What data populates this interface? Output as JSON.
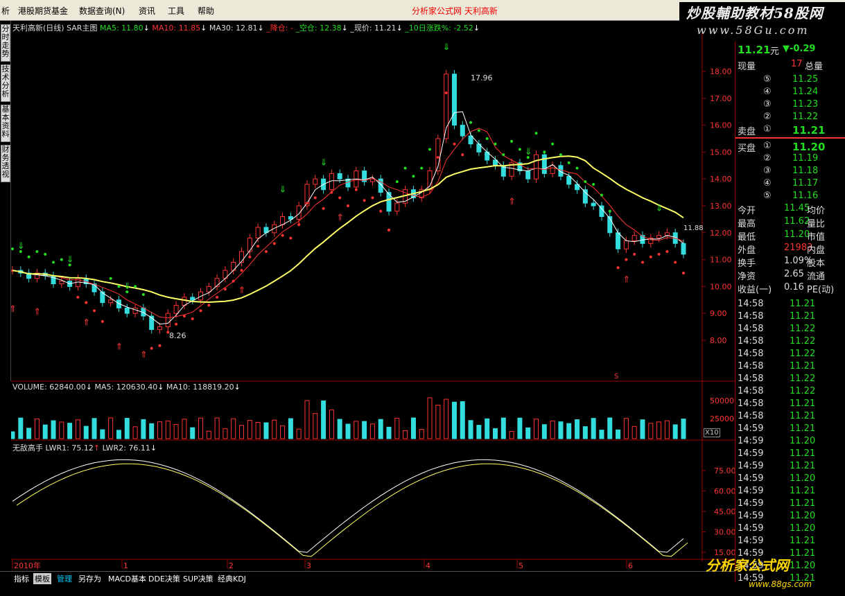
{
  "menu": {
    "items": [
      "析",
      "港股期货基金",
      "数据查询(N)",
      "资讯",
      "工具",
      "帮助"
    ],
    "title": "分析家公式网 天利高新"
  },
  "brand": {
    "name": "炒股輔助教材58股网",
    "url": "www.58Gu.com"
  },
  "sidetabs": [
    "分时走势",
    "技术分析",
    "基本资料",
    "财务透视"
  ],
  "main_info": {
    "stock": "天利高新(日线)",
    "indicator": "SAR主图",
    "ma5": "MA5: 11.80",
    "ma10": "MA10: 11.85",
    "ma30": "MA30: 12.81",
    "drop": "_降仓: -",
    "empty": "_空仓: 12.38",
    "price": "_现价: 11.21",
    "change10": "_10日涨跌%: -2.52"
  },
  "annotations": {
    "high": "17.96",
    "low": "8.26",
    "last": "11.88",
    "s_marker": "S"
  },
  "price_axis": [
    "18.00",
    "17.00",
    "16.00",
    "15.00",
    "14.00",
    "13.00",
    "12.00",
    "11.00",
    "10.00",
    "9.00",
    "8.00"
  ],
  "volume_info": {
    "label": "VOLUME: 62840.00",
    "ma5": "MA5: 120630.40",
    "ma10": "MA10: 118819.20"
  },
  "volume_axis": [
    "50000",
    "25000"
  ],
  "volume_unit": "X10",
  "osc_info": {
    "name": "无敌高手",
    "lwr1": "LWR1: 75.12",
    "lwr2": "LWR2: 76.11"
  },
  "osc_axis": [
    "75.00",
    "60.00",
    "45.00",
    "30.00",
    "15.00"
  ],
  "date_axis": [
    "2010年",
    "1",
    "2",
    "3",
    "4",
    "5",
    "6"
  ],
  "bottom_tabs": [
    "指标",
    "模板",
    "管理",
    "另存为",
    "MACD基本",
    "DDE决策",
    "SUP决策",
    "经典KDJ"
  ],
  "quote": {
    "price": "11.21",
    "unit": "元",
    "change": "▼-0.29",
    "volume_label": "现量",
    "volume": "17",
    "total_label": "总量",
    "sell_label": "卖盘",
    "buy_label": "买盘",
    "sells": [
      {
        "n": "⑤",
        "p": "11.25"
      },
      {
        "n": "④",
        "p": "11.24"
      },
      {
        "n": "③",
        "p": "11.23"
      },
      {
        "n": "②",
        "p": "11.22"
      },
      {
        "n": "①",
        "p": "11.21"
      }
    ],
    "buys": [
      {
        "n": "①",
        "p": "11.20"
      },
      {
        "n": "②",
        "p": "11.19"
      },
      {
        "n": "③",
        "p": "11.18"
      },
      {
        "n": "④",
        "p": "11.17"
      },
      {
        "n": "⑤",
        "p": "11.16"
      }
    ],
    "stats": [
      {
        "l": "今开",
        "v": "11.45",
        "r": "均价"
      },
      {
        "l": "最高",
        "v": "11.62",
        "r": "量比"
      },
      {
        "l": "最低",
        "v": "11.20",
        "r": "市值"
      },
      {
        "l": "外盘",
        "v": "21983",
        "r": "内盘"
      },
      {
        "l": "换手",
        "v": "1.09%",
        "r": "股本"
      },
      {
        "l": "净资",
        "v": "2.65",
        "r": "流通"
      },
      {
        "l": "收益(一)",
        "v": "0.16",
        "r": "PE(动)"
      }
    ],
    "ticks": [
      {
        "t": "14:58",
        "p": "11.21"
      },
      {
        "t": "14:58",
        "p": "11.21"
      },
      {
        "t": "14:58",
        "p": "11.22"
      },
      {
        "t": "14:58",
        "p": "11.22"
      },
      {
        "t": "14:58",
        "p": "11.22"
      },
      {
        "t": "14:58",
        "p": "11.21"
      },
      {
        "t": "14:58",
        "p": "11.22"
      },
      {
        "t": "14:58",
        "p": "11.22"
      },
      {
        "t": "14:58",
        "p": "11.21"
      },
      {
        "t": "14:58",
        "p": "11.21"
      },
      {
        "t": "14:59",
        "p": "11.21"
      },
      {
        "t": "14:59",
        "p": "11.20"
      },
      {
        "t": "14:59",
        "p": "11.21"
      },
      {
        "t": "14:59",
        "p": "11.21"
      },
      {
        "t": "14:59",
        "p": "11.20"
      },
      {
        "t": "14:59",
        "p": "11.21"
      },
      {
        "t": "14:59",
        "p": "11.21"
      },
      {
        "t": "14:59",
        "p": "11.20"
      },
      {
        "t": "14:59",
        "p": "11.20"
      },
      {
        "t": "14:59",
        "p": "11.21"
      },
      {
        "t": "14:59",
        "p": "11.21"
      },
      {
        "t": "14:59",
        "p": "11.20"
      },
      {
        "t": "14:59",
        "p": "11.21"
      }
    ]
  },
  "logo": {
    "text": "分析家公式网",
    "url": "www.88gs.com"
  },
  "colors": {
    "up": "#ff3333",
    "down": "#33dddd",
    "ma_yellow": "#ffff66",
    "sar_green": "#22dd22",
    "sar_red": "#ff3333"
  }
}
